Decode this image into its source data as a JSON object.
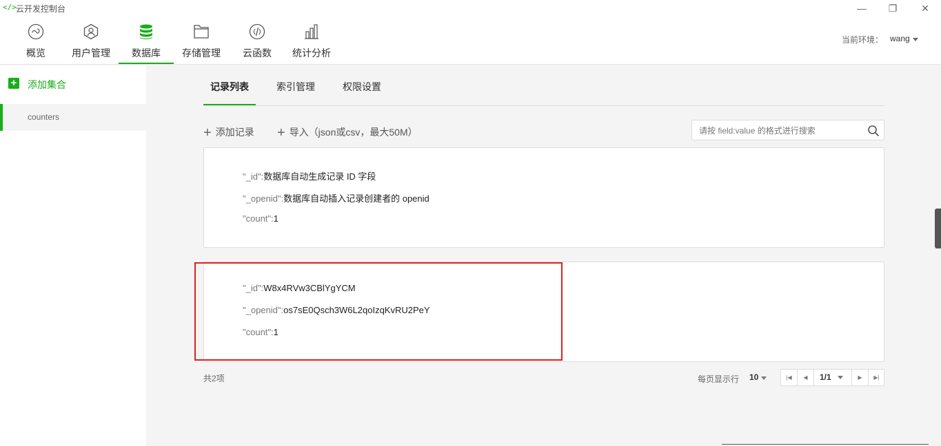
{
  "window": {
    "app_icon": "</>",
    "title": "云开发控制台",
    "minimize": "—",
    "maximize": "❐",
    "close": "✕"
  },
  "nav": {
    "items": [
      {
        "label": "概览",
        "icon": "overview-icon"
      },
      {
        "label": "用户管理",
        "icon": "user-icon"
      },
      {
        "label": "数据库",
        "icon": "database-icon",
        "active": true
      },
      {
        "label": "存储管理",
        "icon": "folder-icon"
      },
      {
        "label": "云函数",
        "icon": "function-icon"
      },
      {
        "label": "统计分析",
        "icon": "chart-icon"
      }
    ],
    "env_label": "当前环境：",
    "env_value": "wang"
  },
  "sidebar": {
    "add_label": "添加集合",
    "collections": [
      "counters"
    ]
  },
  "tabs": [
    "记录列表",
    "索引管理",
    "权限设置"
  ],
  "toolbar": {
    "add_record": "添加记录",
    "import": "导入（json或csv，最大50M）"
  },
  "search": {
    "placeholder": "请按 field:value 的格式进行搜索"
  },
  "records": [
    {
      "id_key": "\"_id\":",
      "id_value": "数据库自动生成记录 ID 字段",
      "openid_key": "\"_openid\":",
      "openid_value": "数据库自动插入记录创建者的 openid",
      "count_key": "\"count\":",
      "count_value": "1"
    },
    {
      "id_key": "\"_id\":",
      "id_value": "W8x4RVw3CBlYgYCM",
      "openid_key": "\"_openid\":",
      "openid_value": "os7sE0Qsch3W6L2qoIzqKvRU2PeY",
      "count_key": "\"count\":",
      "count_value": "1"
    }
  ],
  "footer": {
    "total": "共2项",
    "per_page_label": "每页显示行",
    "per_page_value": "10",
    "page": "1/1"
  },
  "colors": {
    "accent": "#1aad19",
    "highlight": "#e0201f"
  }
}
